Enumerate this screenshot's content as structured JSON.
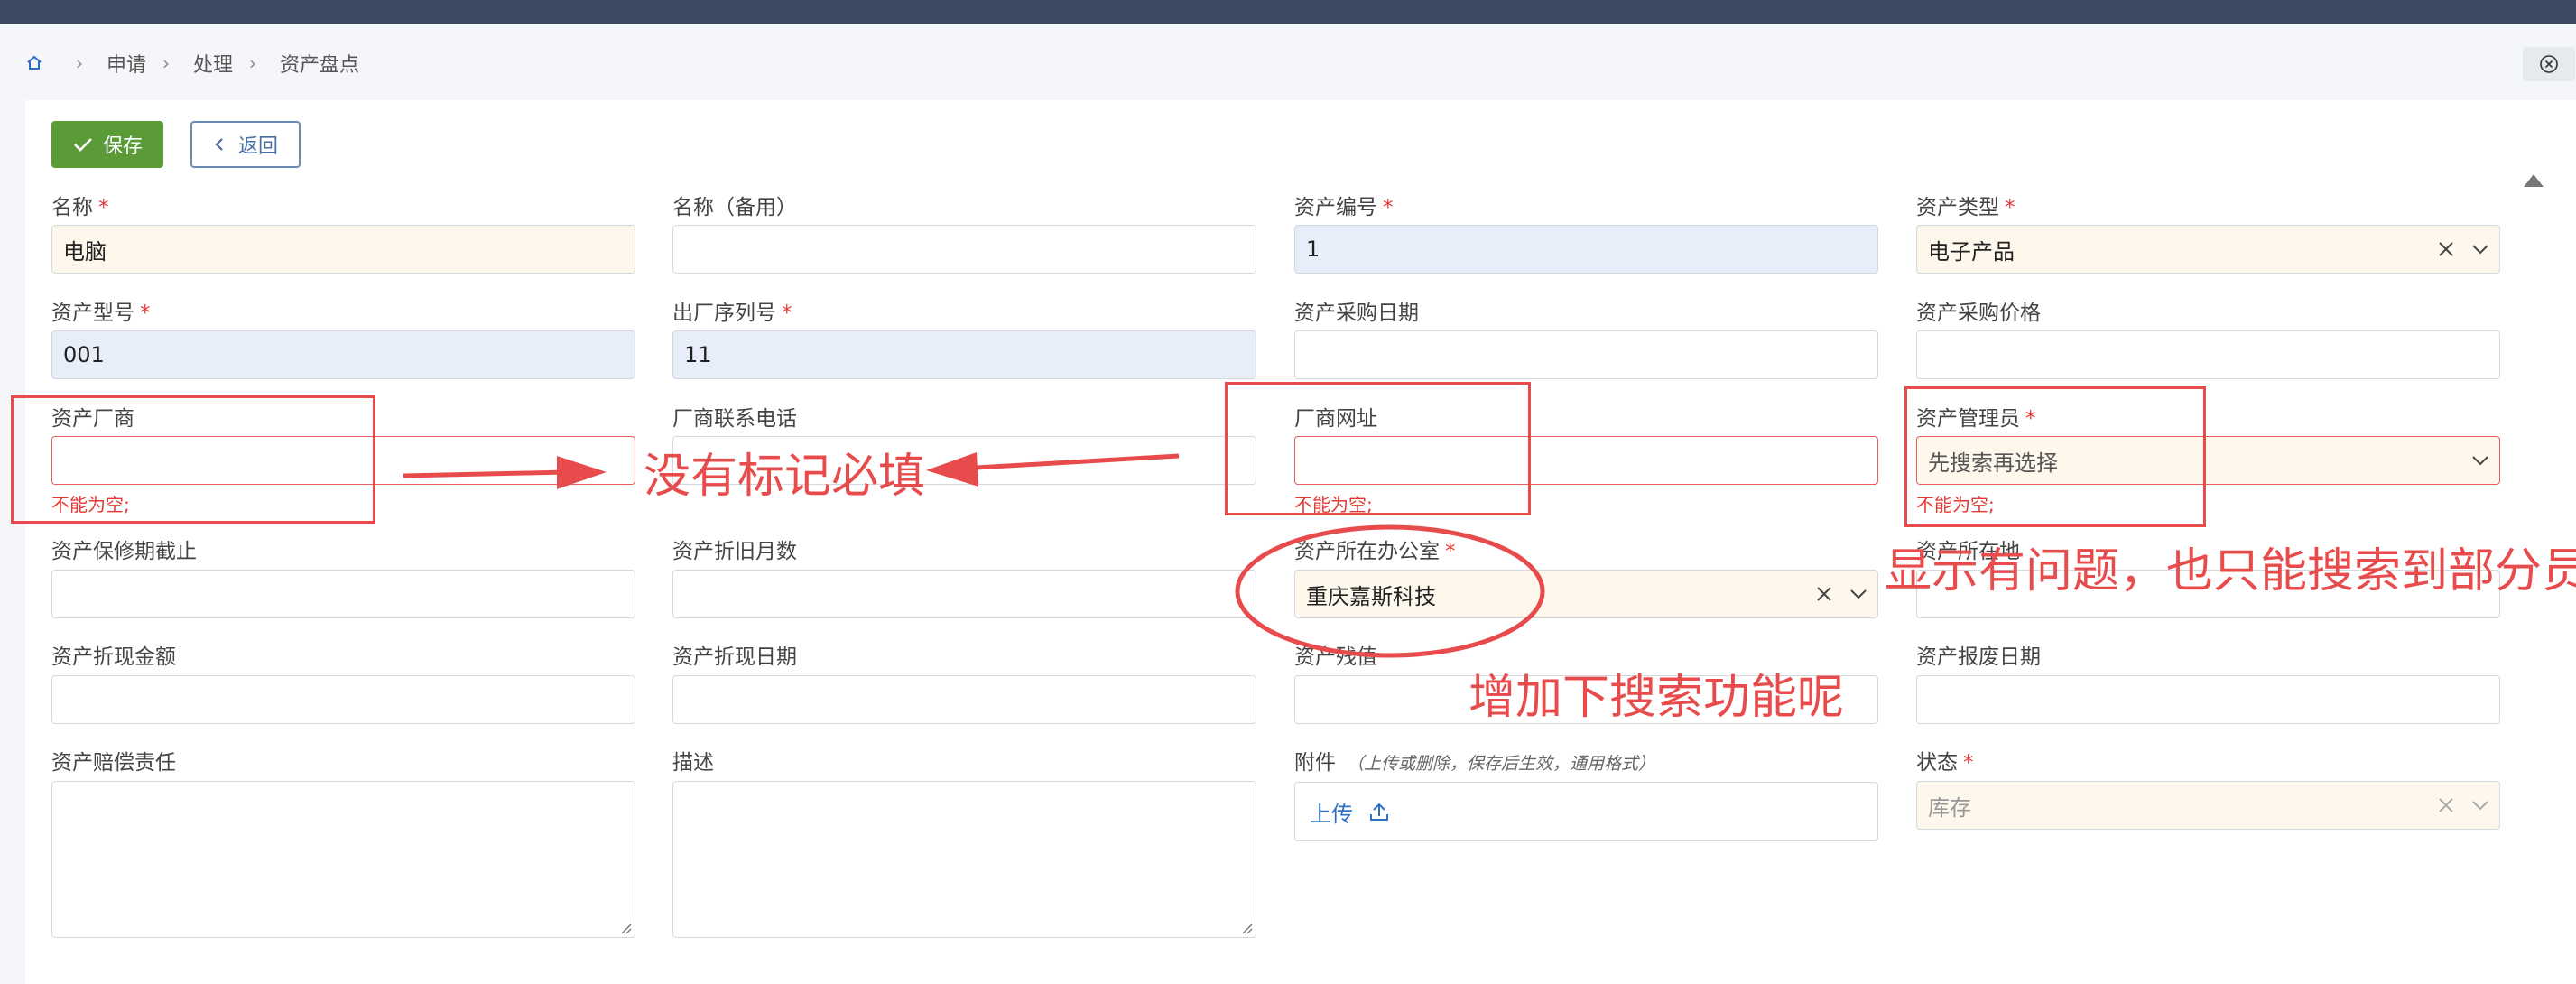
{
  "breadcrumb": {
    "items": [
      "申请",
      "处理",
      "资产盘点"
    ]
  },
  "toolbar": {
    "save_label": "保存",
    "back_label": "返回"
  },
  "form": {
    "name": {
      "label": "名称",
      "value": "电脑"
    },
    "name_alt": {
      "label": "名称（备用）",
      "value": ""
    },
    "asset_no": {
      "label": "资产编号",
      "value": "1"
    },
    "asset_type": {
      "label": "资产类型",
      "value": "电子产品"
    },
    "model": {
      "label": "资产型号",
      "value": "001"
    },
    "serial": {
      "label": "出厂序列号",
      "value": "11"
    },
    "purchase_date": {
      "label": "资产采购日期",
      "value": ""
    },
    "purchase_price": {
      "label": "资产采购价格",
      "value": ""
    },
    "vendor": {
      "label": "资产厂商",
      "value": "",
      "error": "不能为空;"
    },
    "vendor_phone": {
      "label": "厂商联系电话",
      "value": ""
    },
    "vendor_site": {
      "label": "厂商网址",
      "value": "",
      "error": "不能为空;"
    },
    "manager": {
      "label": "资产管理员",
      "placeholder": "先搜索再选择",
      "error": "不能为空;"
    },
    "warranty": {
      "label": "资产保修期截止",
      "value": ""
    },
    "depr_months": {
      "label": "资产折旧月数",
      "value": ""
    },
    "office": {
      "label": "资产所在办公室",
      "value": "重庆嘉斯科技"
    },
    "location": {
      "label": "资产所在地",
      "value": ""
    },
    "cash_amount": {
      "label": "资产折现金额",
      "value": ""
    },
    "cash_date": {
      "label": "资产折现日期",
      "value": ""
    },
    "residual": {
      "label": "资产残值",
      "value": ""
    },
    "scrap_date": {
      "label": "资产报废日期",
      "value": ""
    },
    "liability": {
      "label": "资产赔偿责任",
      "value": ""
    },
    "description": {
      "label": "描述",
      "value": ""
    },
    "attachment": {
      "label": "附件",
      "hint": "（上传或删除，保存后生效，通用格式）",
      "upload_label": "上传"
    },
    "status": {
      "label": "状态",
      "value": "库存"
    }
  },
  "annotations": {
    "required_note": "没有标记必填",
    "manager_note": "显示有问题，也只能搜索到部分员工",
    "office_note": "增加下搜索功能呢"
  },
  "colors": {
    "accent_green": "#5a9a37",
    "annotation_red": "#e84b4b",
    "required_red": "#e53935",
    "topbar": "#3d4a63"
  }
}
